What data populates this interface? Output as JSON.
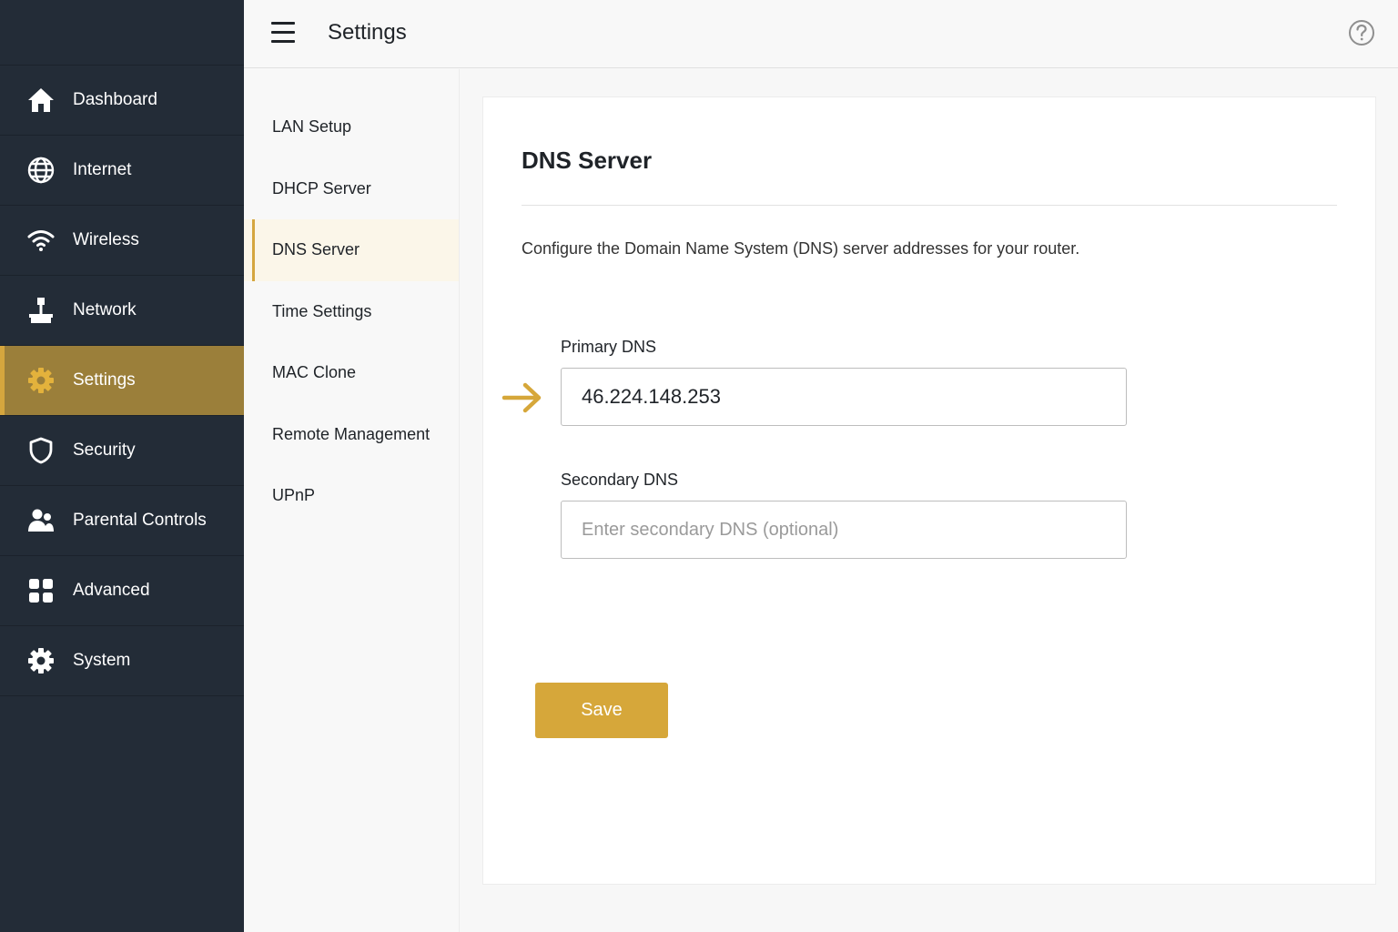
{
  "header": {
    "title": "Settings"
  },
  "colors": {
    "sidebar_bg": "#232c37",
    "accent": "#d5a63e",
    "active_bg": "#9b7f3a"
  },
  "sidebar": {
    "items": [
      {
        "label": "Dashboard",
        "icon": "home-icon"
      },
      {
        "label": "Internet",
        "icon": "globe-icon"
      },
      {
        "label": "Wireless",
        "icon": "wifi-icon"
      },
      {
        "label": "Network",
        "icon": "network-icon"
      },
      {
        "label": "Settings",
        "icon": "gear-icon",
        "active": true
      },
      {
        "label": "Security",
        "icon": "shield-icon"
      },
      {
        "label": "Parental Controls",
        "icon": "users-icon"
      },
      {
        "label": "Advanced",
        "icon": "grid-icon"
      },
      {
        "label": "System",
        "icon": "cog-icon"
      }
    ]
  },
  "subnav": {
    "items": [
      {
        "label": "LAN Setup"
      },
      {
        "label": "DHCP Server"
      },
      {
        "label": "DNS Server",
        "active": true
      },
      {
        "label": "Time Settings"
      },
      {
        "label": "MAC Clone"
      },
      {
        "label": "Remote Management"
      },
      {
        "label": "UPnP"
      }
    ]
  },
  "main": {
    "title": "DNS Server",
    "description": "Configure the Domain Name System (DNS) server addresses for your router.",
    "primary_dns": {
      "label": "Primary DNS",
      "value": "46.224.148.253"
    },
    "secondary_dns": {
      "label": "Secondary DNS",
      "value": "",
      "placeholder": "Enter secondary DNS (optional)"
    },
    "save_label": "Save"
  }
}
